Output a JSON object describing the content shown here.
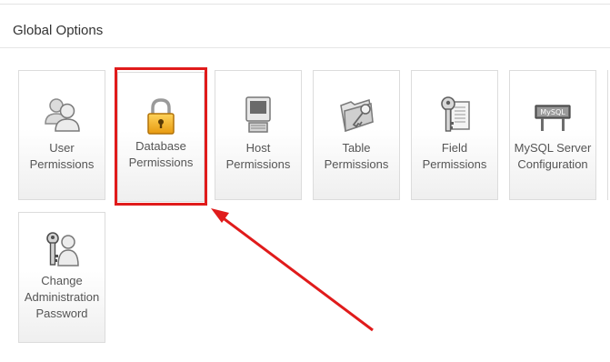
{
  "section": {
    "title": "Global Options"
  },
  "tiles": [
    {
      "label": "User Permissions",
      "lines": [
        "User",
        "Permissions"
      ],
      "icon": "users-icon"
    },
    {
      "label": "Database Permissions",
      "lines": [
        "Database",
        "Permissions"
      ],
      "icon": "lock-icon"
    },
    {
      "label": "Host Permissions",
      "lines": [
        "Host",
        "Permissions"
      ],
      "icon": "computer-icon"
    },
    {
      "label": "Table Permissions",
      "lines": [
        "Table",
        "Permissions"
      ],
      "icon": "folder-key-icon"
    },
    {
      "label": "Field Permissions",
      "lines": [
        "Field",
        "Permissions"
      ],
      "icon": "key-document-icon"
    },
    {
      "label": "MySQL Server Configuration",
      "lines": [
        "MySQL Server",
        "Configuration"
      ],
      "icon": "mysql-sign-icon",
      "sign_text": "MySQL"
    },
    {
      "label": "Change Administration Password",
      "lines": [
        "Change",
        "Administration",
        "Password"
      ],
      "icon": "keys-user-icon"
    }
  ],
  "colors": {
    "highlight": "#e01b1b",
    "tile_border": "#dcdcdc"
  }
}
